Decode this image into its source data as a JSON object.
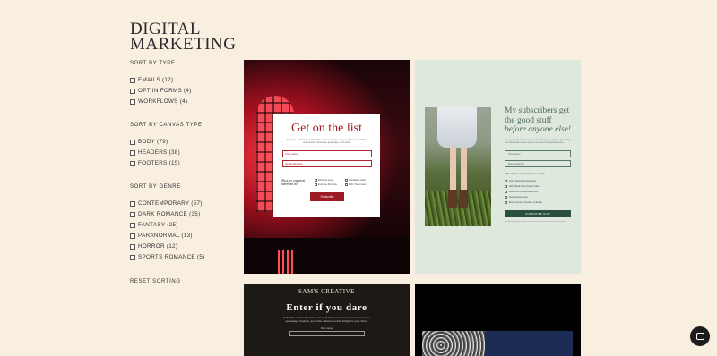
{
  "brand": {
    "line1": "DIGITAL",
    "line2": "MARKETING"
  },
  "filters": [
    {
      "title": "SORT BY TYPE",
      "options": [
        {
          "label": "EMAILS (12)"
        },
        {
          "label": "OPT IN FORMS (4)"
        },
        {
          "label": "WORKFLOWS (4)"
        }
      ]
    },
    {
      "title": "SORT BY CANVAS TYPE",
      "options": [
        {
          "label": "BODY (79)"
        },
        {
          "label": "HEADERS (38)"
        },
        {
          "label": "FOOTERS (15)"
        }
      ]
    },
    {
      "title": "SORT BY GENRE",
      "options": [
        {
          "label": "CONTEMPORARY (57)"
        },
        {
          "label": "DARK ROMANCE (35)"
        },
        {
          "label": "FANTASY (25)"
        },
        {
          "label": "PARANORMAL (13)"
        },
        {
          "label": "HORROR (12)"
        },
        {
          "label": "SPORTS ROMANCE (5)"
        }
      ]
    }
  ],
  "reset_label": "RESET SORTING",
  "cards": {
    "c1": {
      "title": "Get on the list",
      "desc": "For goals. For being nearby, first and new release news, exclusive subscriber-only content, discounts, giveaways, and more!",
      "field1": "First name",
      "field2": "Email address",
      "question": "What are you most interested in?",
      "checks": [
        "Romance series",
        "Standalone reads",
        "Exclusive first looks",
        "ARC / Street team",
        "",
        ""
      ],
      "button": "Subscribe",
      "foot": "Unsubscribe at any time. Privacy"
    },
    "c2": {
      "title1": "My subscribers get",
      "title2": "the good stuff",
      "title3": "before anyone else!",
      "desc": "Join my list for release news, bonus chapters, exclusive giveaways, and behind-the-scenes peeks you won't find anywhere else.",
      "field1": "First Name",
      "field2": "Email Address",
      "question": "What do you want to get more news?",
      "checks": [
        "Cover Reveals & Giveaways",
        "ARC / Book Street Team Invites",
        "Behind the Scenes Author Life",
        "New Release Alerts",
        "Bonus Content, Freebies, & Extras"
      ],
      "button": "SUBSCRIBE NOW",
      "foot": "By subscribing, you agree to receive emails and can unsubscribe at any time."
    },
    "c3": {
      "brand": "SAM'S CREATIVE",
      "title": "Enter if you dare",
      "desc": "Subscribe and be the first to know all about new releases, bonus scenes, giveaways, freebies, and other delicious extras straight to your inbox!",
      "label": "First name"
    }
  },
  "icons": {
    "chat": "chat-bubble-icon"
  },
  "colors": {
    "background": "#f8efe1",
    "accent_red": "#9e1b24",
    "accent_green": "#29503f"
  }
}
